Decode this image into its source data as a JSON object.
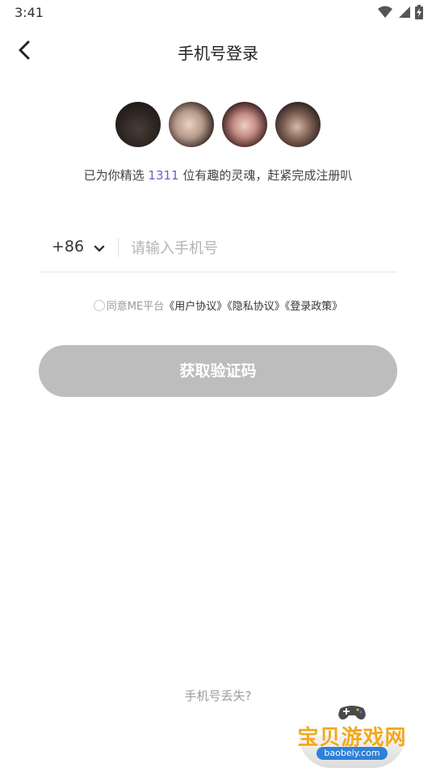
{
  "status_bar": {
    "time": "3:41"
  },
  "header": {
    "title": "手机号登录"
  },
  "invite": {
    "prefix": "已为你精选 ",
    "count": "1311",
    "suffix": " 位有趣的灵魂，赶紧完成注册叭"
  },
  "phone": {
    "country_code": "+86",
    "placeholder": "请输入手机号",
    "value": ""
  },
  "agreement": {
    "prefix": "同意ME平台",
    "links": [
      "《用户协议》",
      "《隐私协议》",
      "《登录政策》"
    ]
  },
  "submit": {
    "label": "获取验证码"
  },
  "footer": {
    "lost_phone": "手机号丢失?"
  },
  "watermark": {
    "title": "宝贝游戏网",
    "url": "baobeiy.com"
  },
  "colors": {
    "accent": "#6c5fc8",
    "button_disabled": "#bdbdbd",
    "placeholder": "#b3b3b3"
  }
}
